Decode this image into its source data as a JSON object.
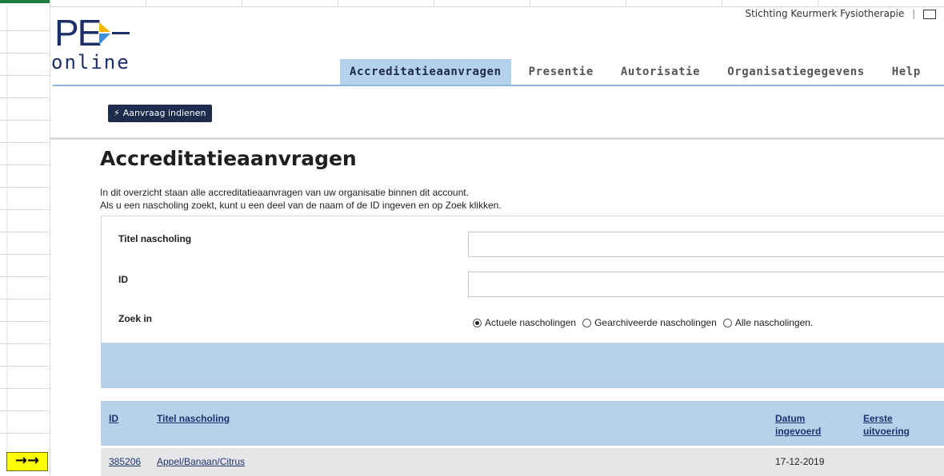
{
  "header": {
    "logo_top": "PE",
    "logo_bottom": "online",
    "organization": "Stichting Keurmerk Fysiotherapie",
    "separator": "|"
  },
  "nav": {
    "tabs": [
      {
        "label": "Accreditatieaanvragen",
        "active": true
      },
      {
        "label": "Presentie",
        "active": false
      },
      {
        "label": "Autorisatie",
        "active": false
      },
      {
        "label": "Organisatiegegevens",
        "active": false
      },
      {
        "label": "Help",
        "active": false
      }
    ]
  },
  "actions": {
    "submit_label": "Aanvraag indienen"
  },
  "page": {
    "title": "Accreditatieaanvragen",
    "intro_line1": "In dit overzicht staan alle accreditatieaanvragen van uw organisatie binnen dit account.",
    "intro_line2": "Als u een nascholing zoekt, kunt u een deel van de naam of de ID ingeven en op Zoek klikken."
  },
  "search": {
    "title_label": "Titel nascholing",
    "title_value": "",
    "id_label": "ID",
    "id_value": "",
    "scope_label": "Zoek in",
    "scope_options": [
      {
        "label": "Actuele nascholingen",
        "checked": true
      },
      {
        "label": "Gearchiveerde nascholingen",
        "checked": false
      },
      {
        "label": "Alle nascholingen.",
        "checked": false
      }
    ]
  },
  "table": {
    "col_id": "ID",
    "col_title": "Titel nascholing",
    "col_date_line1": "Datum",
    "col_date_line2": "ingevoerd",
    "col_first_line1": "Eerste",
    "col_first_line2": "uitvoering",
    "rows": [
      {
        "id": "385206",
        "title": "Appel/Banaan/Citrus",
        "date": "17-12-2019",
        "first": ""
      }
    ]
  },
  "spreadsheet": {
    "marker": "→→",
    "marker_color": "#ffff00"
  },
  "colors": {
    "brand_dark": "#1c2f68",
    "tab_active": "#b4d2ec",
    "panel_blue": "#b7d1ea",
    "button": "#1d2c4d"
  }
}
